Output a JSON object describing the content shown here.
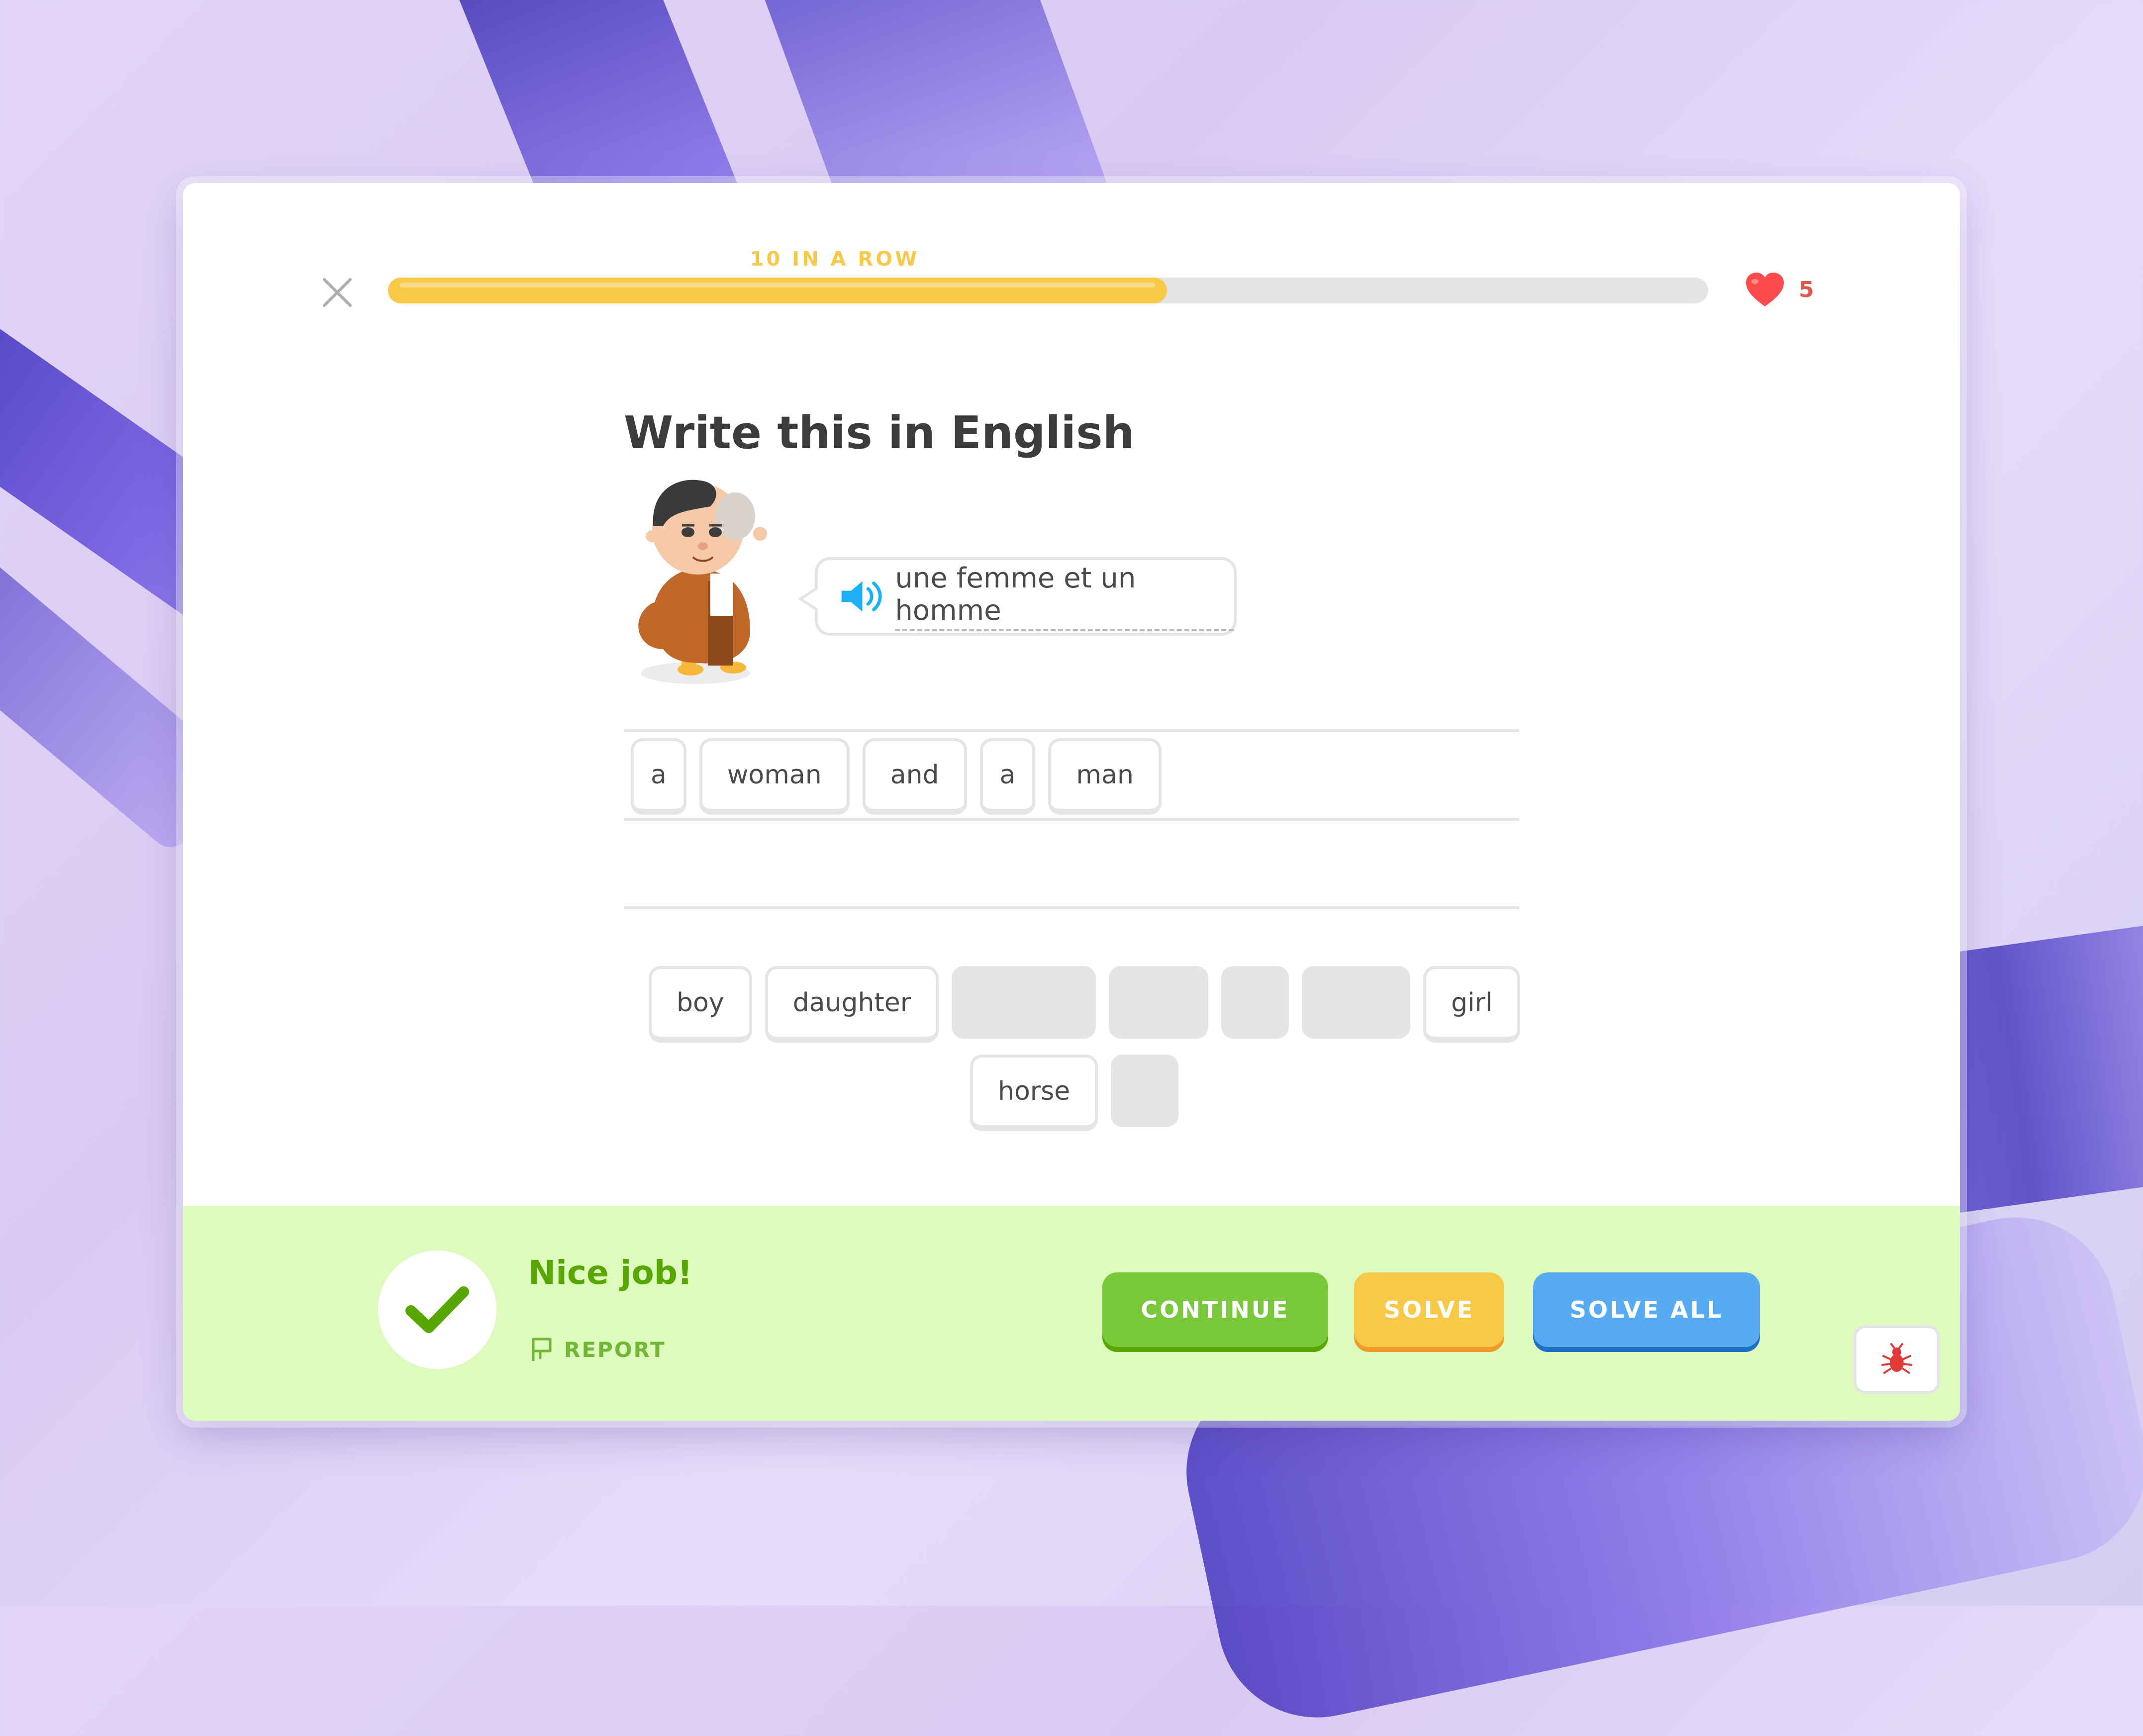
{
  "header": {
    "streak_label": "10 IN A ROW",
    "progress_fraction": 0.59,
    "hearts_count": "5",
    "progress_color": "#f8c846",
    "heart_color": "#e2574c"
  },
  "lesson": {
    "title": "Write this in English",
    "prompt_text": "une femme et un homme"
  },
  "answer": {
    "tiles": [
      "a",
      "woman",
      "and",
      "a",
      "man"
    ]
  },
  "word_bank": {
    "row1": [
      "boy",
      "daughter",
      "",
      "",
      "",
      "",
      "girl"
    ],
    "row2": [
      "horse",
      ""
    ]
  },
  "footer": {
    "message": "Nice job!",
    "report_label": "REPORT",
    "continue_label": "CONTINUE",
    "solve_label": "SOLVE",
    "solve_all_label": "SOLVE ALL",
    "background_color": "#ddfbbc",
    "continue_color": "#78c83a",
    "solve_color": "#f8c846",
    "solve_all_color": "#57abf2"
  },
  "icons": {
    "close": "close-icon",
    "heart": "heart-icon",
    "speaker": "speaker-icon",
    "check": "checkmark-icon",
    "report": "flag-icon",
    "bug": "bug-icon"
  }
}
